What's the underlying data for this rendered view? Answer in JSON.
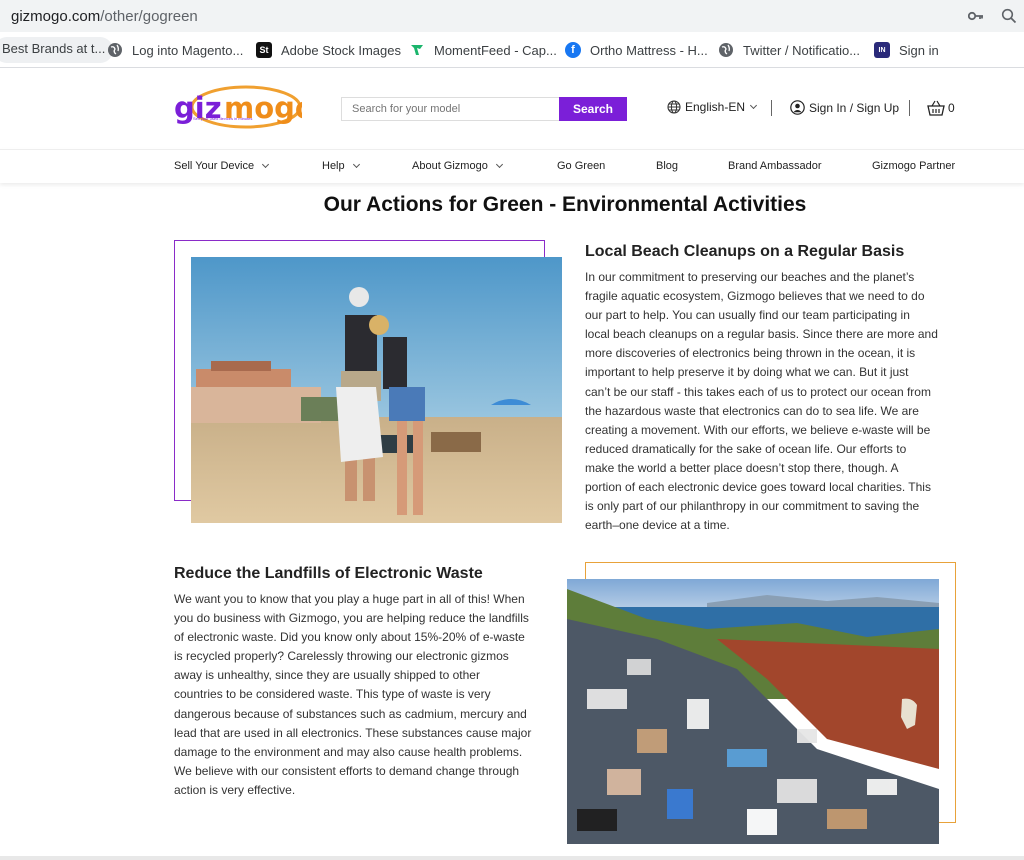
{
  "browser": {
    "url_host": "gizmogo.com",
    "url_path": "/other/gogreen",
    "bookmarks": [
      "Best Brands at t...",
      "Log into Magento...",
      "Adobe Stock Images",
      "MomentFeed - Cap...",
      "Ortho Mattress - H...",
      "Twitter / Notificatio...",
      "Sign in"
    ]
  },
  "header": {
    "logo_text": "gizmogo",
    "logo_tagline": "Sell your used devices in minutes",
    "search_placeholder": "Search for your model",
    "search_button": "Search",
    "language": "English-EN",
    "signin": "Sign In / Sign Up",
    "cart_count": "0"
  },
  "nav": {
    "items": [
      "Sell Your Device",
      "Help",
      "About Gizmogo",
      "Go Green",
      "Blog",
      "Brand Ambassador",
      "Gizmogo Partner"
    ]
  },
  "main": {
    "title": "Our Actions for Green - Environmental Activities",
    "section1": {
      "title": "Local Beach Cleanups on a Regular Basis",
      "lines": [
        "In our commitment to preserving our beaches and the planet’s",
        "fragile aquatic ecosystem, Gizmogo believes that we need to do",
        "our part to help. You can usually find our team participating in",
        "local beach cleanups on a regular basis. Since there are more and",
        "more discoveries of electronics being thrown in the ocean, it is",
        "important to help preserve it by doing what we can. But it just",
        "can’t be our staff - this takes each of us to protect our ocean from",
        "the hazardous waste that electronics can do to sea life. We are",
        "creating a movement. With our efforts, we believe e-waste will be",
        "reduced dramatically for the sake of ocean life. Our efforts to",
        "make the world a better place doesn’t stop there, though. A",
        "portion of each electronic device goes toward local charities. This",
        "is only part of our philanthropy in our commitment to saving the",
        "earth–one device at a time."
      ]
    },
    "section2": {
      "title": "Reduce the Landfills of Electronic Waste",
      "lines": [
        "We want you to know that you play a huge part in all of this! When",
        "you do business with Gizmogo, you are helping reduce the landfills",
        "of electronic waste. Did you know only about 15%-20% of e-waste",
        "is recycled properly? Carelessly throwing our electronic gizmos",
        "away is unhealthy, since they are usually shipped to other",
        "countries to be considered waste. This type of waste is very",
        "dangerous because of substances such as cadmium, mercury and",
        "lead that are used in all electronics. These substances cause major",
        "damage to the environment and may also cause health problems.",
        "We believe with our consistent efforts to demand change through",
        "action is very effective."
      ]
    }
  },
  "colors": {
    "brand_purple": "#7b1fd8",
    "frame_purple": "#8a2bc8",
    "frame_orange": "#e8a23a"
  }
}
